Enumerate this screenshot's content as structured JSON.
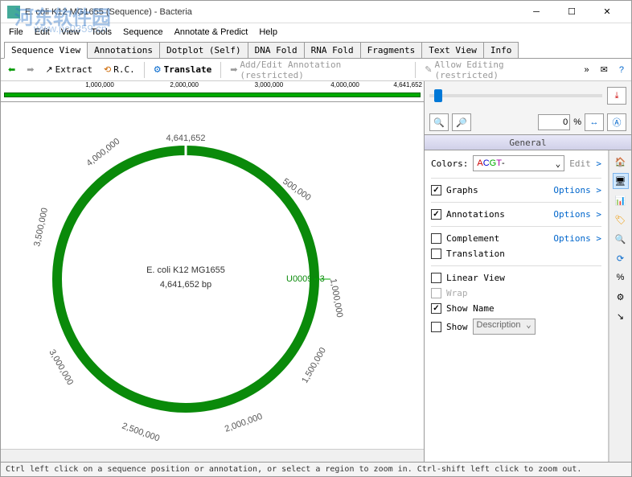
{
  "window": {
    "title": "E. coli K12 MG1655 (Sequence) - Bacteria"
  },
  "watermark": {
    "main": "河东软件园",
    "sub": "www.pc0359.cn"
  },
  "menu": [
    "File",
    "Edit",
    "View",
    "Tools",
    "Sequence",
    "Annotate & Predict",
    "Help"
  ],
  "tabs": [
    {
      "label": "Sequence View",
      "active": true
    },
    {
      "label": "Annotations"
    },
    {
      "label": "Dotplot (Self)"
    },
    {
      "label": "DNA Fold"
    },
    {
      "label": "RNA Fold"
    },
    {
      "label": "Fragments"
    },
    {
      "label": "Text View"
    },
    {
      "label": "Info"
    }
  ],
  "toolbar": {
    "extract": "Extract",
    "rc": "R.C.",
    "translate": "Translate",
    "addedit": "Add/Edit Annotation (restricted)",
    "allow": "Allow Editing (restricted)"
  },
  "ruler": {
    "ticks": [
      "1,000,000",
      "2,000,000",
      "3,000,000",
      "4,000,000",
      "4,641,652"
    ]
  },
  "sequence": {
    "name": "E. coli K12 MG1655",
    "length_label": "4,641,652 bp",
    "accession": "U00096.3",
    "ring_labels": [
      "4,641,652",
      "500,000",
      "1,000,000",
      "1,500,000",
      "2,000,000",
      "2,500,000",
      "3,000,000",
      "3,500,000",
      "4,000,000"
    ]
  },
  "side": {
    "zoom_value": "0",
    "zoom_unit": "%",
    "section": "General",
    "colors_label": "Colors:",
    "colors_value": "A C G T -",
    "edit": "Edit",
    "graphs": "Graphs",
    "annotations": "Annotations",
    "options": "Options",
    "complement": "Complement",
    "translation": "Translation",
    "linear": "Linear View",
    "wrap": "Wrap",
    "showname": "Show Name",
    "show": "Show",
    "desc": "Description"
  },
  "status": "Ctrl left click on a sequence position or annotation, or select a region to zoom in. Ctrl-shift left click to zoom out."
}
